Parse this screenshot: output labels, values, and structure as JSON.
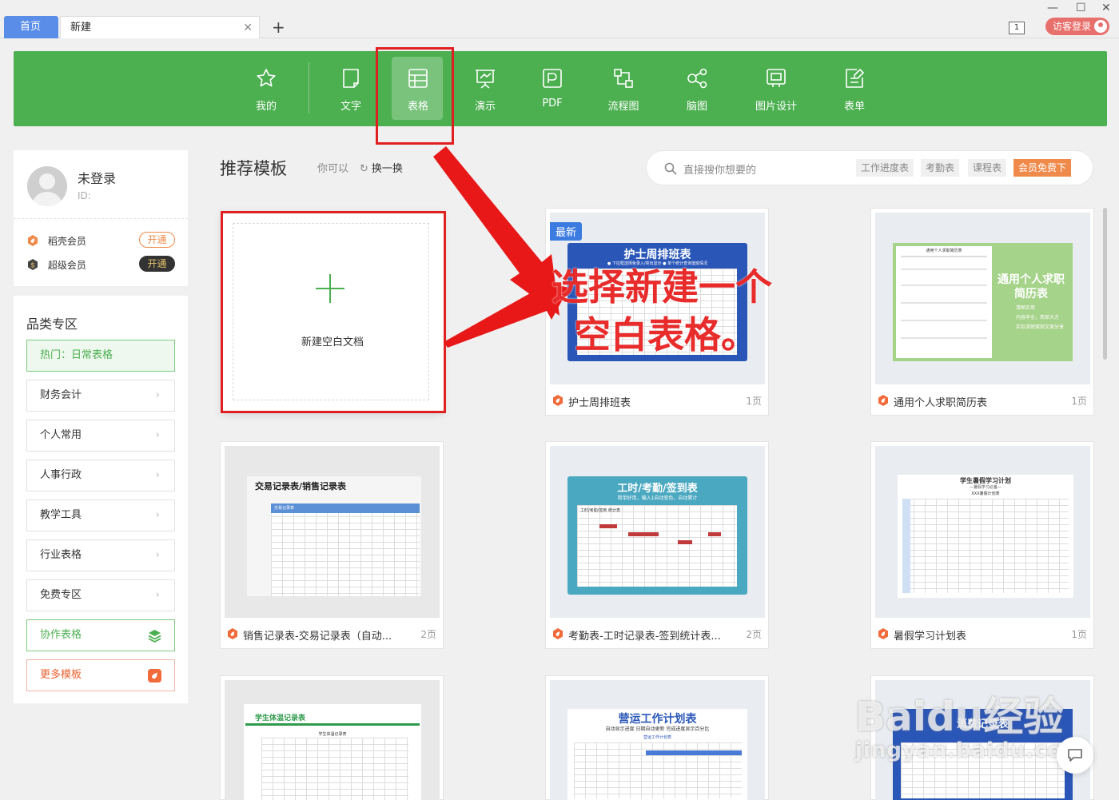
{
  "tabs": {
    "home": "首页",
    "doc": "新建",
    "close": "✕",
    "new_tab": "+"
  },
  "window": {
    "badge": "1",
    "login": "访客登录",
    "min": "—",
    "max": "☐",
    "close": "✕"
  },
  "nav": [
    {
      "label": "我的",
      "icon": "star-icon"
    },
    {
      "label": "文字",
      "icon": "document-icon"
    },
    {
      "label": "表格",
      "icon": "spreadsheet-icon"
    },
    {
      "label": "演示",
      "icon": "presentation-icon"
    },
    {
      "label": "PDF",
      "icon": "pdf-icon"
    },
    {
      "label": "流程图",
      "icon": "flowchart-icon"
    },
    {
      "label": "脑图",
      "icon": "mindmap-icon"
    },
    {
      "label": "图片设计",
      "icon": "image-design-icon"
    },
    {
      "label": "表单",
      "icon": "form-icon"
    }
  ],
  "active_nav": "表格",
  "user": {
    "name": "未登录",
    "id": "ID:"
  },
  "vip": [
    {
      "label": "稻壳会员",
      "button": "开通",
      "color": "#f08a4b"
    },
    {
      "label": "超级会员",
      "button": "开通",
      "color": "#333333"
    }
  ],
  "categories": {
    "title": "品类专区",
    "hot": "热门：日常表格",
    "items": [
      "财务会计",
      "个人常用",
      "人事行政",
      "教学工具",
      "行业表格",
      "免费专区"
    ],
    "collab": "协作表格",
    "more": "更多模板",
    "chevron": "›"
  },
  "main": {
    "heading": "推荐模板",
    "sub": "你可以",
    "refresh_icon": "↻",
    "refresh": "换一换"
  },
  "search": {
    "placeholder": "直接搜你想要的",
    "tags": [
      "工作进度表",
      "考勤表",
      "课程表"
    ],
    "vip_tag": "会员免费下"
  },
  "blank": {
    "label": "新建空白文档"
  },
  "templates": [
    {
      "title": "护士周排班表",
      "pages": "1页",
      "badge": "最新",
      "thumb_title": "护士周排班表",
      "thumb_sub": "● 下拉框选择免录入/突出显示      ● 单个统计查询值班情况"
    },
    {
      "title": "通用个人求职简历表",
      "pages": "1页",
      "thumb_title": "通用个人求职简历表",
      "thumb_head": "通用个人求职简历表",
      "thumb_items": [
        "清晰实用",
        "内容丰全，简单大方",
        "实际求职案例文案分享"
      ]
    },
    {
      "title": "销售记录表-交易记录表（自动...",
      "pages": "2页",
      "thumb_title": "交易记录表/销售记录表",
      "thumb_sub": "交易记录表"
    },
    {
      "title": "考勤表-工时记录表-签到统计表...",
      "pages": "2页",
      "thumb_title": "工时/考勤/签到表",
      "thumb_sub": "简单好用，输入1自动变色，自动累计",
      "thumb_label": "工时/考勤/签到 统计表"
    },
    {
      "title": "暑假学习计划表",
      "pages": "1页",
      "thumb_title": "学生暑假学习计划",
      "thumb_sub": "—暑假学习必备—",
      "thumb_label": "XXX暑假计划表"
    },
    {
      "title": "学生体温记录表",
      "thumb_title": "学生体温记录表",
      "thumb_label": "学生体温记录表"
    },
    {
      "title": "营运工作计划表",
      "thumb_title": "营运工作计划表",
      "thumb_sub": "自动显示进度   日期自动更新   完成进度显示百分比",
      "thumb_label": "营运工作计划表"
    },
    {
      "title": "消费记录表",
      "thumb_title": "消费记录表"
    }
  ],
  "annotation": {
    "line1": "选择新建一个",
    "line2": "空白表格。",
    "color": "#e02020"
  },
  "watermark": {
    "brand": "Baidu经验",
    "url": "jingyan.baidu.com"
  },
  "colors": {
    "green": "#4caf50",
    "blue_tab": "#5a8de8",
    "orange": "#f08a4b"
  }
}
